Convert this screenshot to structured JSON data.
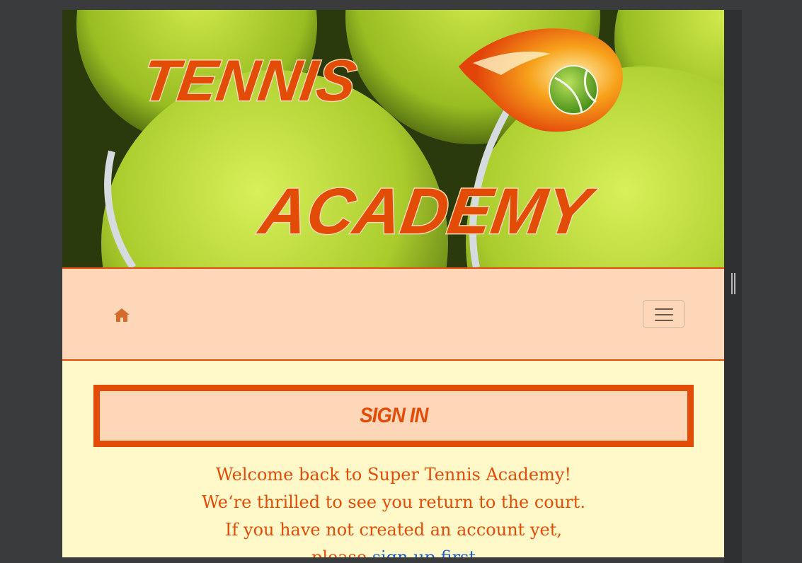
{
  "banner": {
    "title_line1": "TENNIS",
    "title_line2": "ACADEMY"
  },
  "navbar": {
    "home_icon": "home-icon",
    "menu_icon": "hamburger-menu-icon"
  },
  "signin": {
    "heading": "SIGN IN",
    "welcome_line": "Welcome back to Super Tennis Academy!",
    "message": "We‘re thrilled to see you return to the court. If you have not created an account yet, please",
    "signup_link": "sign up first"
  },
  "colors": {
    "accent": "#e24c07",
    "navbar_bg": "#fed7b8",
    "page_bg": "#fff9c9",
    "link": "#1f5fbf"
  }
}
